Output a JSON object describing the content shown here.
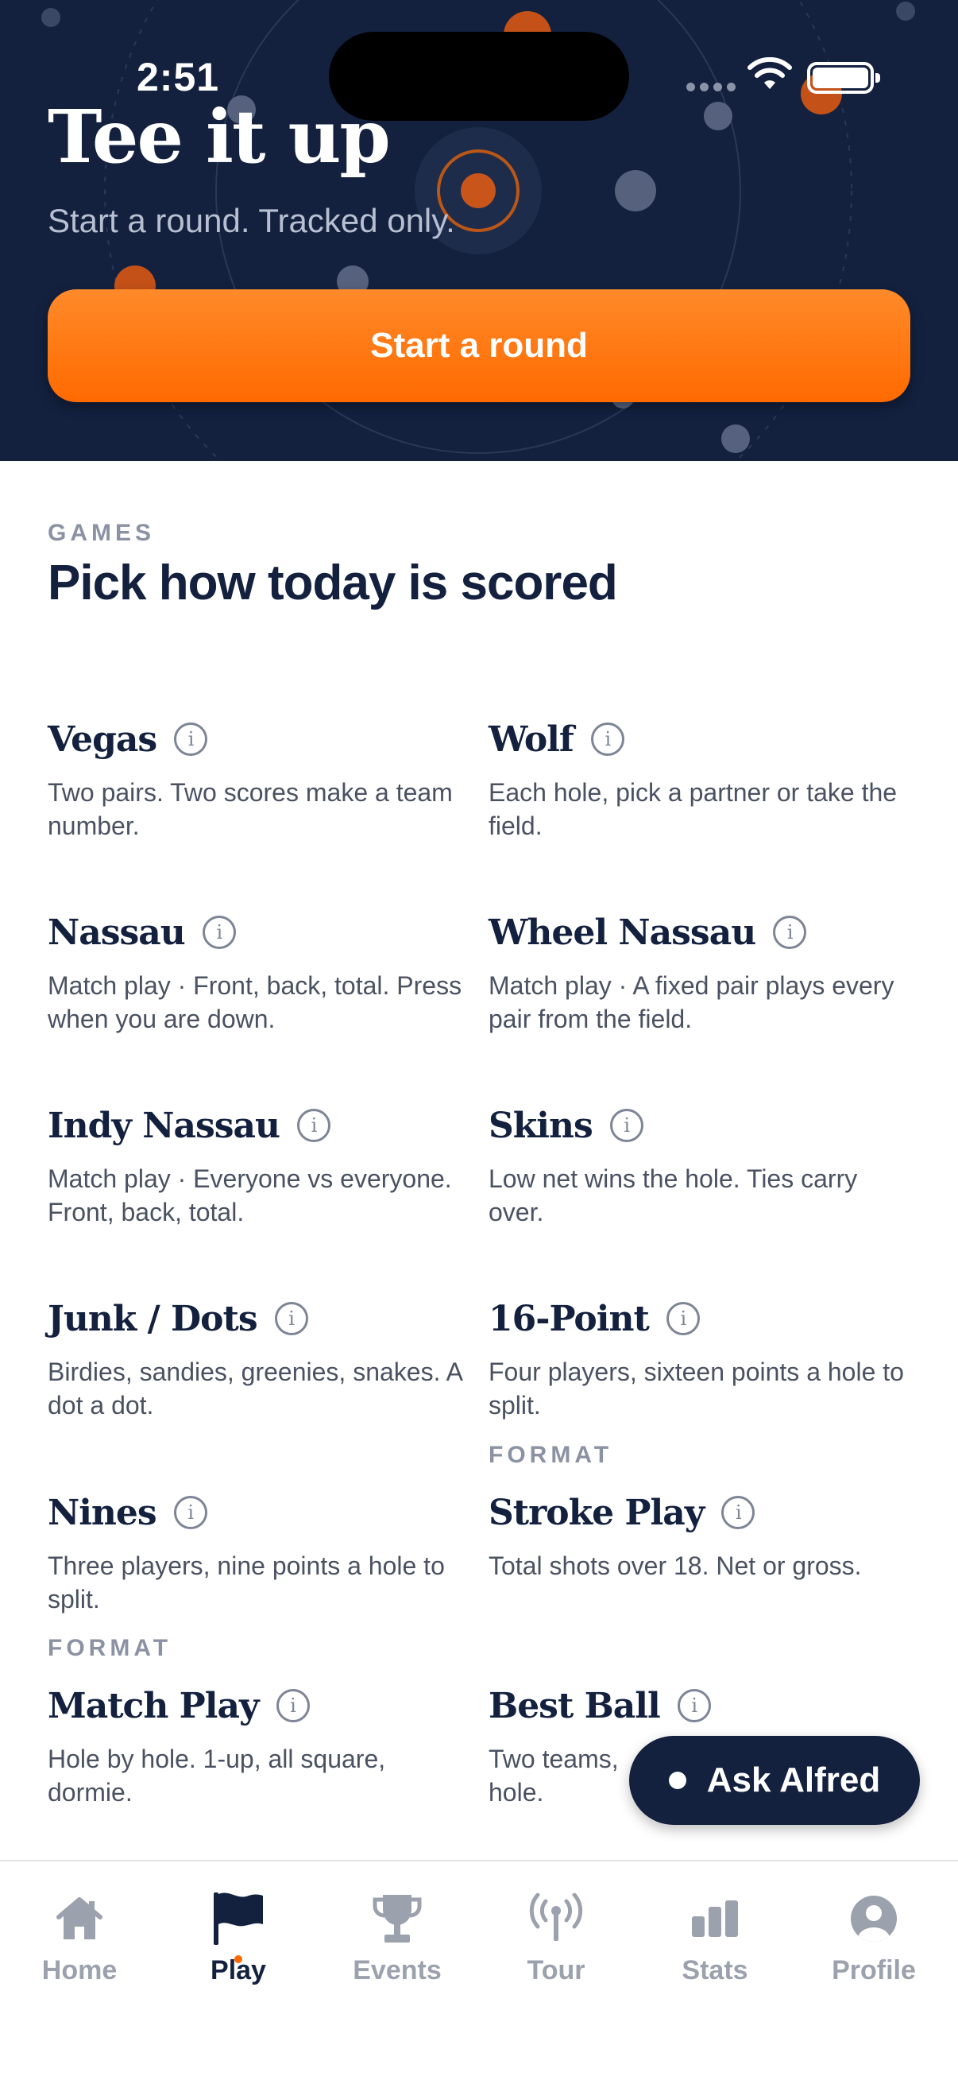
{
  "status_bar": {
    "time": "2:51"
  },
  "hero": {
    "title": "Tee it up",
    "subtitle": "Start a round. Tracked only.",
    "start_button": "Start a round"
  },
  "games_section": {
    "kicker": "GAMES",
    "title": "Pick how today is scored",
    "info_glyph": "i",
    "format_label": "FORMAT",
    "items": [
      {
        "name": "Vegas",
        "desc": "Two pairs. Two scores make a team number."
      },
      {
        "name": "Wolf",
        "desc": "Each hole, pick a partner or take the field."
      },
      {
        "name": "Nassau",
        "desc": "Match play · Front, back, total. Press when you are down."
      },
      {
        "name": "Wheel Nassau",
        "desc": "Match play · A fixed pair plays every pair from the field."
      },
      {
        "name": "Indy Nassau",
        "desc": "Match play · Everyone vs everyone. Front, back, total."
      },
      {
        "name": "Skins",
        "desc": "Low net wins the hole. Ties carry over."
      },
      {
        "name": "Junk / Dots",
        "desc": "Birdies, sandies, greenies, snakes. A dot a dot."
      },
      {
        "name": "16-Point",
        "desc": "Four players, sixteen points a hole to split."
      },
      {
        "name": "Nines",
        "desc": "Three players, nine points a hole to split."
      },
      {
        "name": "Stroke Play",
        "desc": "Total shots over 18. Net or gross."
      },
      {
        "name": "Match Play",
        "desc": "Hole by hole. 1-up, all square, dormie."
      },
      {
        "name": "Best Ball",
        "desc": "Two teams, hole."
      }
    ]
  },
  "ask_button": {
    "label": "Ask Alfred"
  },
  "tab_bar": {
    "tabs": [
      {
        "label": "Home",
        "icon": "home-icon"
      },
      {
        "label": "Play",
        "icon": "flag-icon",
        "active": true
      },
      {
        "label": "Events",
        "icon": "trophy-icon"
      },
      {
        "label": "Tour",
        "icon": "broadcast-icon"
      },
      {
        "label": "Stats",
        "icon": "bar-chart-icon"
      },
      {
        "label": "Profile",
        "icon": "user-icon"
      }
    ]
  },
  "colors": {
    "navy": "#13213f",
    "orange": "#ff6a00",
    "muted": "#8b92a3"
  }
}
